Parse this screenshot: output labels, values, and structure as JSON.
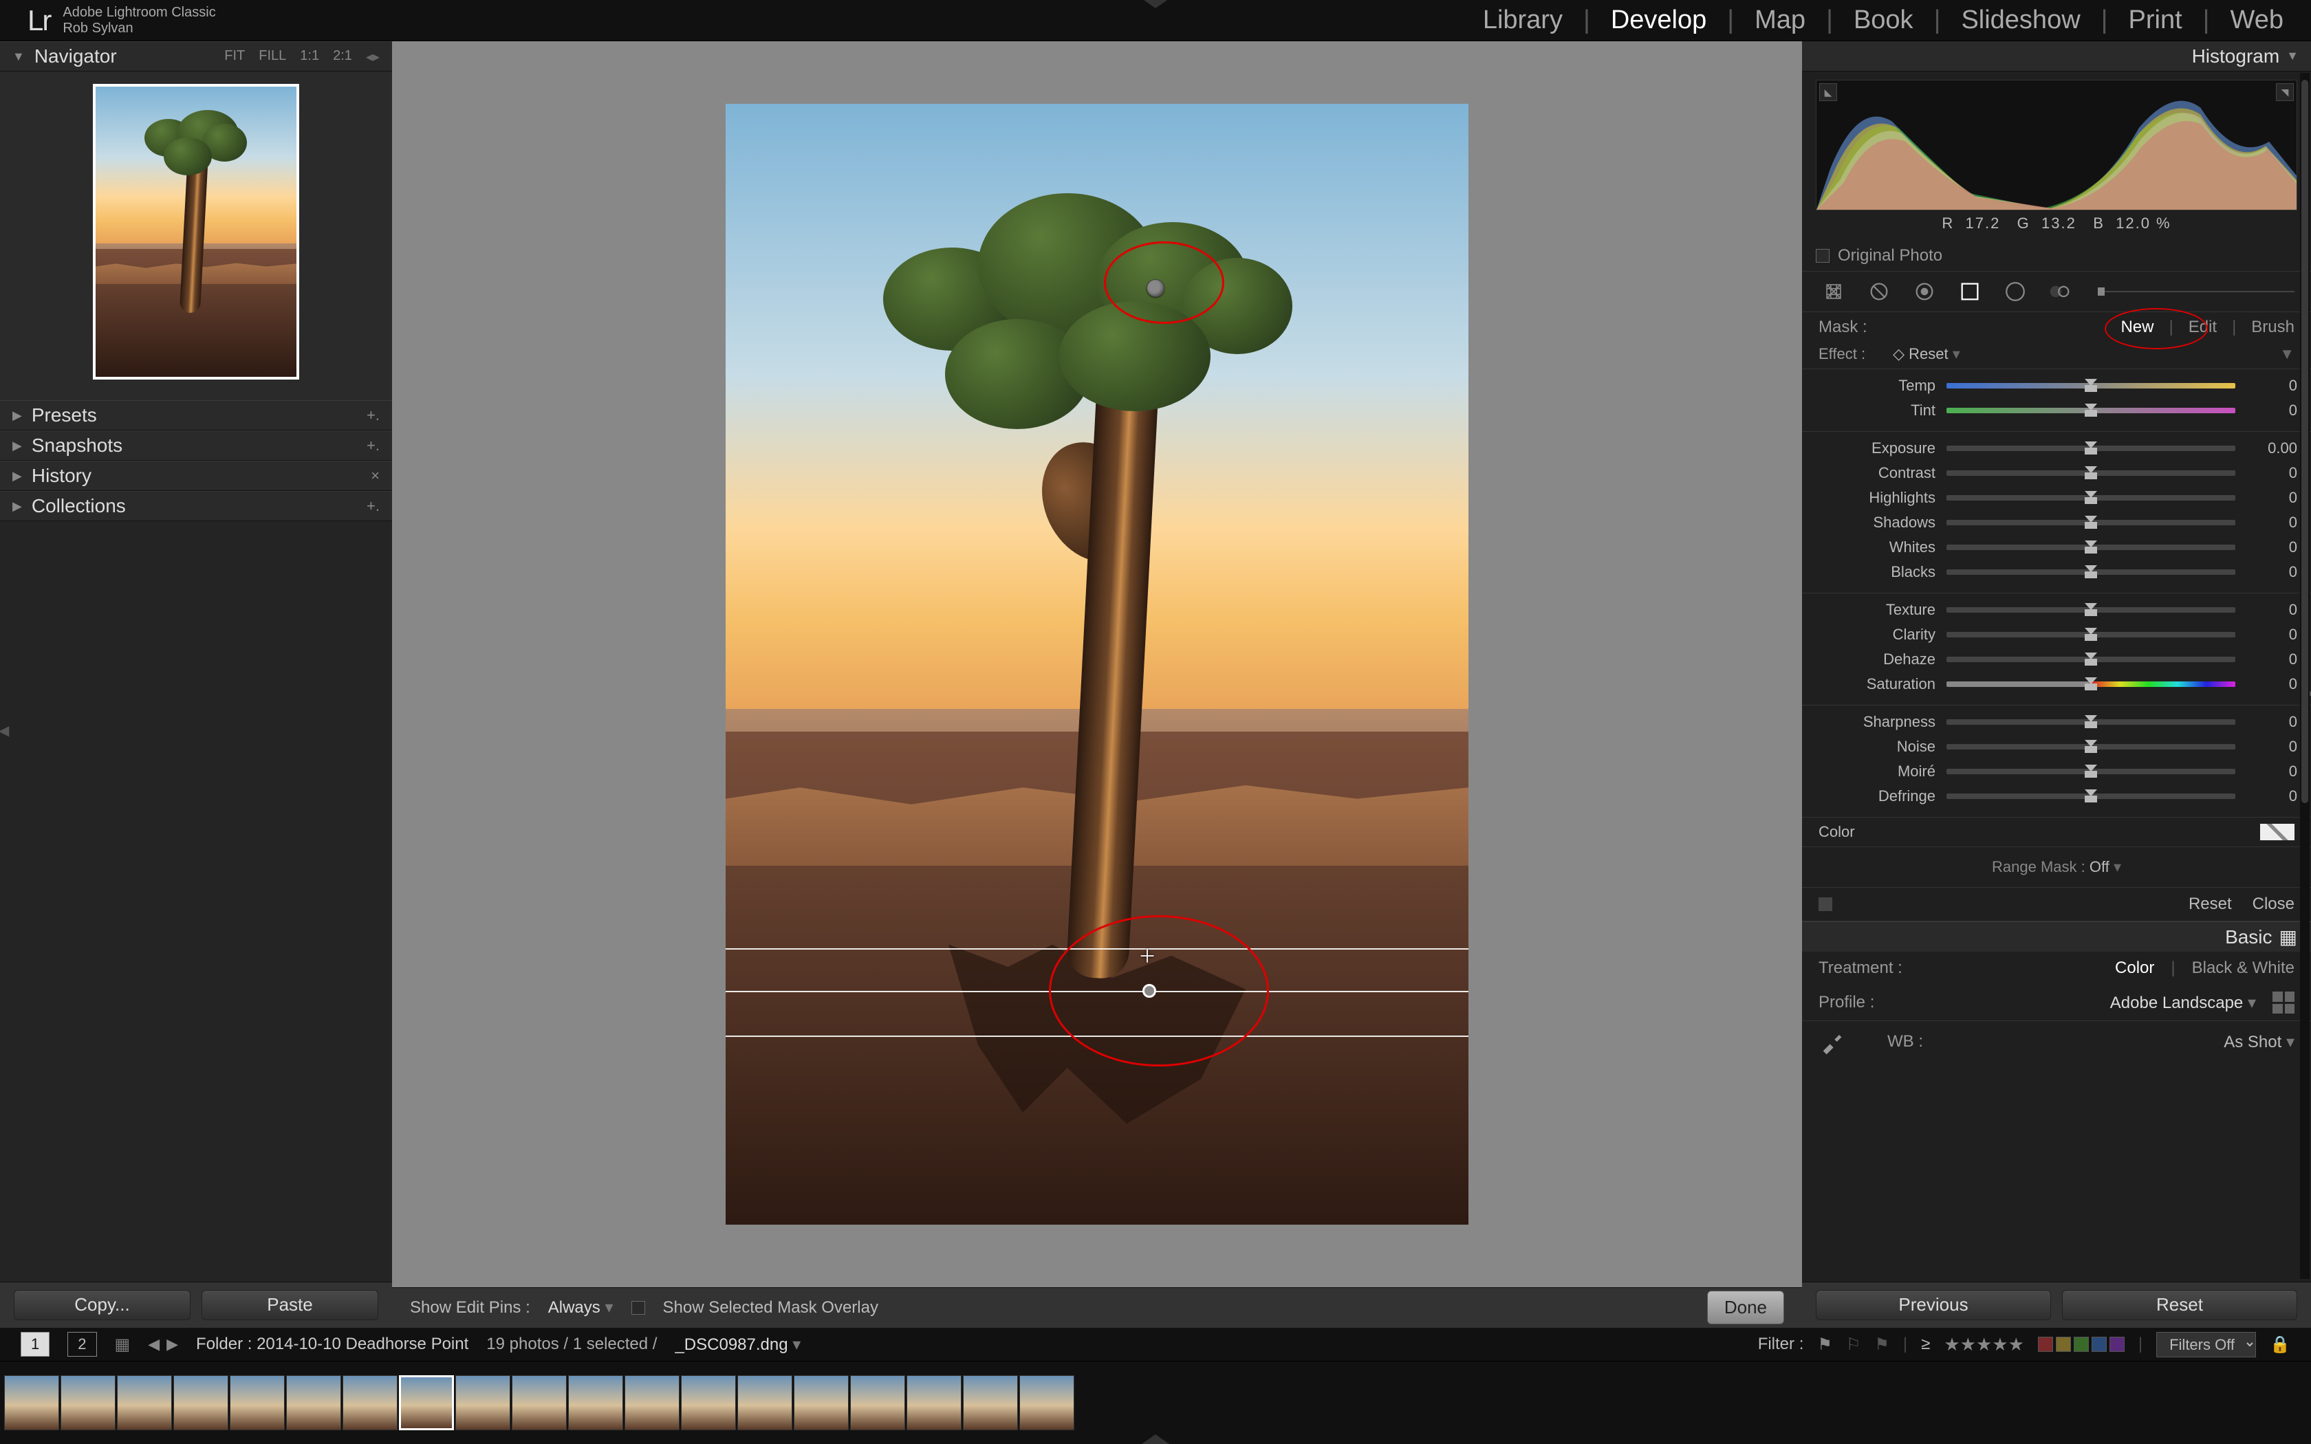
{
  "app": {
    "title": "Adobe Lightroom Classic",
    "user": "Rob Sylvan",
    "logo": "Lr"
  },
  "modules": {
    "items": [
      "Library",
      "Develop",
      "Map",
      "Book",
      "Slideshow",
      "Print",
      "Web"
    ],
    "active": "Develop"
  },
  "left": {
    "navigator": {
      "title": "Navigator",
      "modes": [
        "FIT",
        "FILL",
        "1:1",
        "2:1"
      ]
    },
    "panels": {
      "presets": "Presets",
      "snapshots": "Snapshots",
      "history": "History",
      "collections": "Collections"
    },
    "buttons": {
      "copy": "Copy...",
      "paste": "Paste"
    }
  },
  "center": {
    "toolbar": {
      "editPinsLabel": "Show Edit Pins :",
      "editPinsValue": "Always",
      "overlayLabel": "Show Selected Mask Overlay",
      "done": "Done"
    }
  },
  "right": {
    "histogram": {
      "title": "Histogram",
      "readout_r_label": "R",
      "readout_r": "17.2",
      "readout_g_label": "G",
      "readout_g": "13.2",
      "readout_b_label": "B",
      "readout_b": "12.0 %"
    },
    "originalPhoto": "Original Photo",
    "mask": {
      "label": "Mask :",
      "modes": [
        "New",
        "Edit",
        "Brush"
      ],
      "active": "New"
    },
    "effect": {
      "label": "Effect :",
      "value": "Reset",
      "prefix": "◇"
    },
    "sliders": {
      "temp": {
        "label": "Temp",
        "value": "0"
      },
      "tint": {
        "label": "Tint",
        "value": "0"
      },
      "exposure": {
        "label": "Exposure",
        "value": "0.00"
      },
      "contrast": {
        "label": "Contrast",
        "value": "0"
      },
      "highlights": {
        "label": "Highlights",
        "value": "0"
      },
      "shadows": {
        "label": "Shadows",
        "value": "0"
      },
      "whites": {
        "label": "Whites",
        "value": "0"
      },
      "blacks": {
        "label": "Blacks",
        "value": "0"
      },
      "texture": {
        "label": "Texture",
        "value": "0"
      },
      "clarity": {
        "label": "Clarity",
        "value": "0"
      },
      "dehaze": {
        "label": "Dehaze",
        "value": "0"
      },
      "saturation": {
        "label": "Saturation",
        "value": "0"
      },
      "sharpness": {
        "label": "Sharpness",
        "value": "0"
      },
      "noise": {
        "label": "Noise",
        "value": "0"
      },
      "moire": {
        "label": "Moiré",
        "value": "0"
      },
      "defringe": {
        "label": "Defringe",
        "value": "0"
      }
    },
    "color": "Color",
    "rangeMask": {
      "label": "Range Mask :",
      "value": "Off"
    },
    "resetClose": {
      "reset": "Reset",
      "close": "Close"
    },
    "basic": {
      "title": "Basic",
      "treatmentLabel": "Treatment :",
      "treatmentColor": "Color",
      "treatmentBW": "Black & White",
      "profileLabel": "Profile :",
      "profileValue": "Adobe Landscape",
      "wbLabel": "WB :",
      "wbValue": "As Shot"
    },
    "buttons": {
      "previous": "Previous",
      "reset": "Reset"
    }
  },
  "filterbar": {
    "pages": [
      "1",
      "2"
    ],
    "folder": "Folder : 2014-10-10 Deadhorse Point",
    "selection": "19 photos / 1 selected /",
    "filename": "_DSC0987.dng",
    "filterLabel": "Filter :",
    "ge": "≥",
    "filtersOff": "Filters Off"
  }
}
